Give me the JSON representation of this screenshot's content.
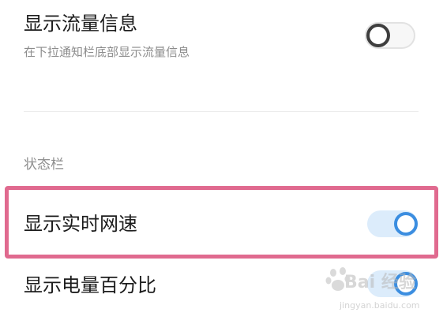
{
  "settings": {
    "traffic_info": {
      "title": "显示流量信息",
      "description": "在下拉通知栏底部显示流量信息",
      "enabled": false
    },
    "status_bar_section": {
      "header": "状态栏"
    },
    "realtime_speed": {
      "title": "显示实时网速",
      "enabled": true
    },
    "battery_percent": {
      "title": "显示电量百分比",
      "enabled": true
    }
  },
  "annotation": {
    "highlight_color": "#e06a8f"
  },
  "watermark": {
    "brand": "Bai 经验",
    "url": "jingyan.baidu.com"
  },
  "colors": {
    "toggle_on_track": "#dcecfb",
    "toggle_on_knob": "#3c8ee0",
    "toggle_off_knob": "#3e3e3e"
  }
}
